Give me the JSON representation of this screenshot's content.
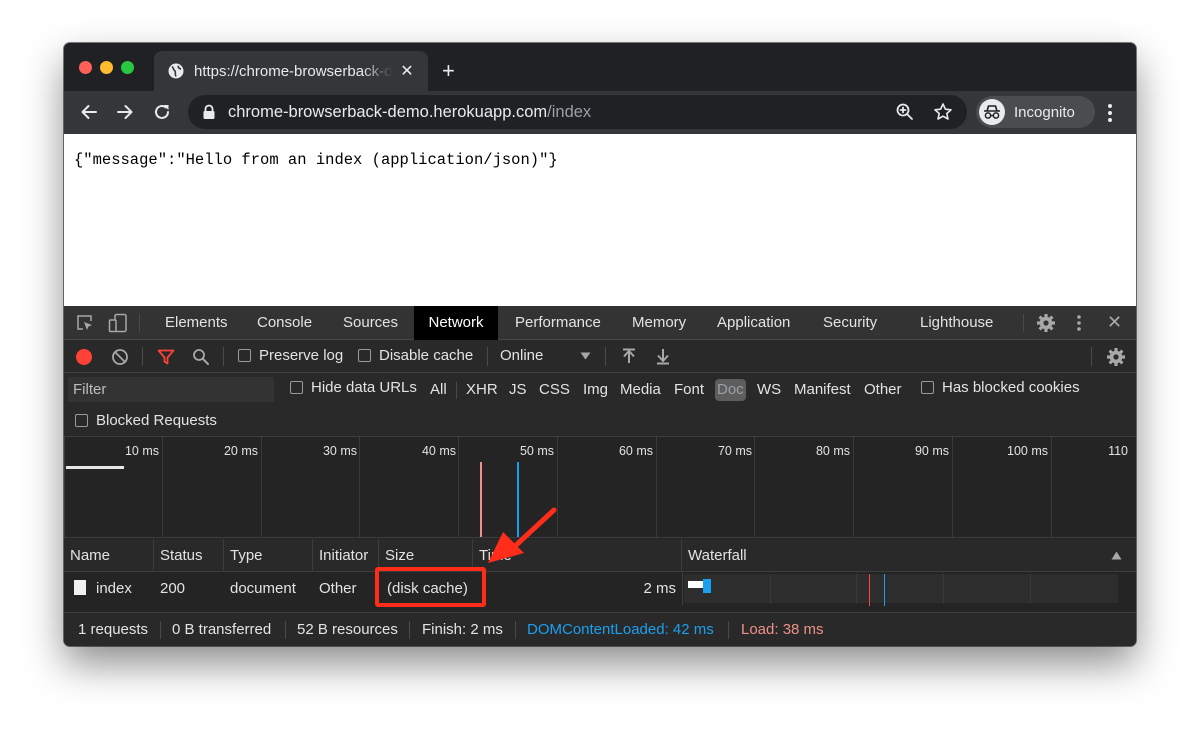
{
  "browser": {
    "tab_title": "https://chrome-browserback-demo.herokuapp.com/index",
    "tab_close": "✕",
    "new_tab": "+",
    "url_host": "chrome-browserback-demo.herokuapp.com",
    "url_path": "/index",
    "profile_label": "Incognito"
  },
  "page": {
    "json_text": "{\"message\":\"Hello from an index (application/json)\"}"
  },
  "devtools": {
    "tabs": [
      "Elements",
      "Console",
      "Sources",
      "Network",
      "Performance",
      "Memory",
      "Application",
      "Security",
      "Lighthouse"
    ],
    "active_tab": "Network",
    "close": "✕",
    "toolbar": {
      "preserve_log": "Preserve log",
      "disable_cache": "Disable cache",
      "throttling": "Online"
    },
    "filter": {
      "placeholder": "Filter",
      "hide_data_urls": "Hide data URLs",
      "types": [
        "All",
        "XHR",
        "JS",
        "CSS",
        "Img",
        "Media",
        "Font",
        "Doc",
        "WS",
        "Manifest",
        "Other"
      ],
      "selected_type": "Doc",
      "has_blocked_cookies": "Has blocked cookies",
      "blocked_requests": "Blocked Requests"
    },
    "timeline": {
      "ticks": [
        "10 ms",
        "20 ms",
        "30 ms",
        "40 ms",
        "50 ms",
        "60 ms",
        "70 ms",
        "80 ms",
        "90 ms",
        "100 ms",
        "110"
      ]
    },
    "table": {
      "columns": [
        "Name",
        "Status",
        "Type",
        "Initiator",
        "Size",
        "Time",
        "Waterfall"
      ],
      "rows": [
        {
          "name": "index",
          "status": "200",
          "type": "document",
          "initiator": "Other",
          "size": "(disk cache)",
          "time": "2 ms"
        }
      ]
    },
    "status_bar": {
      "requests": "1 requests",
      "transferred": "0 B transferred",
      "resources": "52 B resources",
      "finish": "Finish: 2 ms",
      "dom_content_loaded": "DOMContentLoaded: 42 ms",
      "load": "Load: 38 ms"
    },
    "colors": {
      "dom_content_loaded": "#1a9ff0",
      "load": "#f0908a",
      "highlight": "#ff2d1a"
    }
  }
}
